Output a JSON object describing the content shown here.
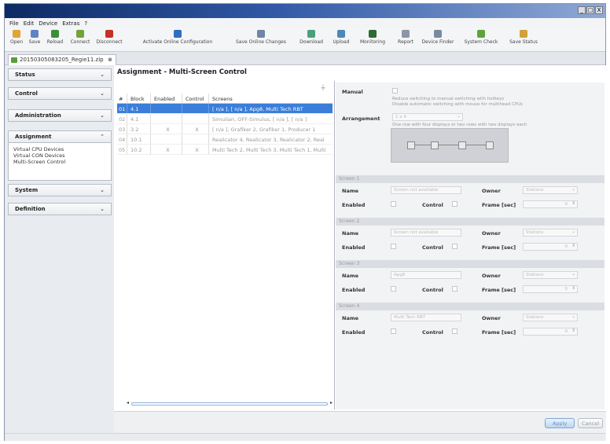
{
  "window": {
    "min_label": "_",
    "max_label": "□",
    "close_label": "X"
  },
  "menu": [
    "File",
    "Edit",
    "Device",
    "Extras",
    "?"
  ],
  "toolbar": [
    {
      "label": "Open",
      "icon": "folder-icon",
      "color": "#e1a532"
    },
    {
      "label": "Save",
      "icon": "disk-icon",
      "color": "#5f84c4"
    },
    {
      "label": "Reload",
      "icon": "reload-icon",
      "color": "#3b8f3b"
    },
    {
      "label": "Connect",
      "icon": "plug-connect-icon",
      "color": "#73a23a"
    },
    {
      "label": "Disconnect",
      "icon": "plug-disconnect-icon",
      "color": "#c3332a"
    },
    {
      "label": "Activate Online Configuration",
      "icon": "activate-icon",
      "color": "#2d6fc0"
    },
    {
      "label": "Save Online Changes",
      "icon": "save-online-icon",
      "color": "#6e86a8"
    },
    {
      "label": "Download",
      "icon": "download-icon",
      "color": "#4aa07d"
    },
    {
      "label": "Upload",
      "icon": "upload-icon",
      "color": "#4d89b8"
    },
    {
      "label": "Monitoring",
      "icon": "monitor-icon",
      "color": "#2f6b33"
    },
    {
      "label": "Report",
      "icon": "report-icon",
      "color": "#8c96a5"
    },
    {
      "label": "Device Finder",
      "icon": "device-finder-icon",
      "color": "#7b89a0"
    },
    {
      "label": "System Check",
      "icon": "check-icon",
      "color": "#5aa53a"
    },
    {
      "label": "Save Status",
      "icon": "save-status-icon",
      "color": "#d1a23a"
    }
  ],
  "file_tab": {
    "label": "20150305083205_Regie11.zip"
  },
  "sidebar": {
    "sections": [
      {
        "label": "Status",
        "state": "collapsed"
      },
      {
        "label": "Control",
        "state": "collapsed"
      },
      {
        "label": "Administration",
        "state": "collapsed"
      },
      {
        "label": "Assignment",
        "state": "expanded"
      },
      {
        "label": "System",
        "state": "collapsed"
      },
      {
        "label": "Definition",
        "state": "collapsed"
      }
    ],
    "assignment_items": [
      "Virtual CPU Devices",
      "Virtual CON Devices",
      "Multi-Screen Control"
    ]
  },
  "main": {
    "title": "Assignment - Multi-Screen Control"
  },
  "table": {
    "headers": [
      "#",
      "Block",
      "Enabled",
      "Control",
      "Screens"
    ],
    "rows": [
      {
        "num": "01",
        "block": "4.1",
        "enabled": "",
        "control": "",
        "screens": "[ n/a ], [ n/a ], Apg8, Multi Tech RBT",
        "selected": true
      },
      {
        "num": "02",
        "block": "4.1",
        "enabled": "",
        "control": "",
        "screens": "Simulian, OFF-Simulus, [ n/a ], [ n/a ]",
        "selected": false
      },
      {
        "num": "03",
        "block": "3.2",
        "enabled": "X",
        "control": "X",
        "screens": "[ n/a ], Grafiker 2, Grafiker 1, Producer 1",
        "selected": false
      },
      {
        "num": "04",
        "block": "10.1",
        "enabled": "",
        "control": "",
        "screens": "Realicator 4, Realicator 3, Realicator 2, Real",
        "selected": false
      },
      {
        "num": "05",
        "block": "10.2",
        "enabled": "X",
        "control": "X",
        "screens": "Multi Tech 2, Multi Tech 3, Multi Tech 1, Multi",
        "selected": false
      }
    ]
  },
  "props": {
    "manual_label": "Manual",
    "manual_note1": "Reduce switching to manual switching with hotkeys",
    "manual_note2": "Disable automatic switching with mouse for multihead CPUs",
    "arrangement_label": "Arrangement",
    "arrangement_value": "1 x 4",
    "arrangement_note": "One row with four displays or two rows with two displays each",
    "screens": [
      {
        "header": "Screen 1",
        "name_label": "Name",
        "name_value": "Screen not available",
        "owner_label": "Owner",
        "owner_value": "Stations",
        "enabled_label": "Enabled",
        "control_label": "Control",
        "frame_label": "Frame [sec]",
        "frame_value": "0"
      },
      {
        "header": "Screen 2",
        "name_label": "Name",
        "name_value": "Screen not available",
        "owner_label": "Owner",
        "owner_value": "Stations",
        "enabled_label": "Enabled",
        "control_label": "Control",
        "frame_label": "Frame [sec]",
        "frame_value": "0"
      },
      {
        "header": "Screen 3",
        "name_label": "Name",
        "name_value": "Apg8",
        "owner_label": "Owner",
        "owner_value": "Stations",
        "enabled_label": "Enabled",
        "control_label": "Control",
        "frame_label": "Frame [sec]",
        "frame_value": "0"
      },
      {
        "header": "Screen 4",
        "name_label": "Name",
        "name_value": "Multi Tech RBT",
        "owner_label": "Owner",
        "owner_value": "Stations",
        "enabled_label": "Enabled",
        "control_label": "Control",
        "frame_label": "Frame [sec]",
        "frame_value": "0"
      }
    ]
  },
  "buttons": {
    "apply": "Apply",
    "cancel": "Cancel"
  }
}
